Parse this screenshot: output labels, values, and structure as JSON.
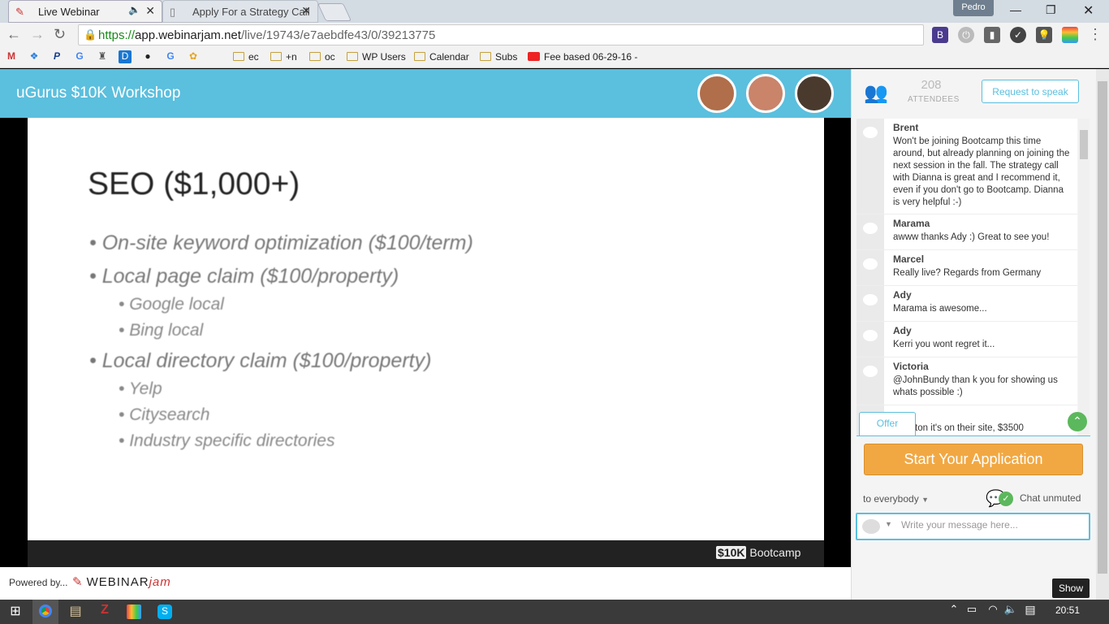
{
  "browser": {
    "tabs": [
      {
        "label": "Live Webinar",
        "icon": "webinarjam-favicon-icon",
        "active": true
      },
      {
        "label": "Apply For a Strategy Call",
        "icon": "page-icon",
        "active": false
      }
    ],
    "profile_name": "Pedro",
    "url": {
      "scheme": "https://",
      "host": "app.webinarjam.net",
      "path": "/live/19743/e7aebdfe43/0/39213775"
    },
    "bookmarks": [
      {
        "label": "ec"
      },
      {
        "label": "+n"
      },
      {
        "label": "oc"
      },
      {
        "label": "WP Users"
      },
      {
        "label": "Calendar"
      },
      {
        "label": "Subs"
      },
      {
        "label": "Fee based 06-29-16 -"
      }
    ]
  },
  "header": {
    "title": "uGurus $10K Workshop",
    "presenters": [
      "presenter-1",
      "presenter-2",
      "presenter-3"
    ]
  },
  "slide": {
    "title": "SEO ($1,000+)",
    "bullets": [
      "On-site keyword optimization ($100/term)",
      "Local page claim ($100/property)",
      "Google local",
      "Bing local",
      "Local directory claim ($100/property)",
      "Yelp",
      "Citysearch",
      "Industry specific directories"
    ],
    "footer_brand_box": "$10K",
    "footer_brand_text": "Bootcamp"
  },
  "powered": {
    "label": "Powered by...",
    "brand_main": "WEBINAR",
    "brand_accent": "jam"
  },
  "panel": {
    "attendees_count": "208",
    "attendees_label": "ATTENDEES",
    "request_button": "Request to speak",
    "messages": [
      {
        "author": "Brent",
        "text": "Won't be joining Bootcamp this time around, but already planning on joining the next session in the fall. The strategy call with Dianna is great and I recommend it, even if you don't go to Bootcamp. Dianna is very helpful :-)"
      },
      {
        "author": "Marama",
        "text": "awww thanks Ady :) Great to see you!"
      },
      {
        "author": "Marcel",
        "text": "Really live? Regards from Germany"
      },
      {
        "author": "Ady",
        "text": "Marama is awesome..."
      },
      {
        "author": "Ady",
        "text": "Kerri you wont regret it..."
      },
      {
        "author": "Victoria",
        "text": "@JohnBundy than k you for showing us whats possible :)"
      },
      {
        "author": "",
        "text": "ton it's on their site, $3500"
      }
    ],
    "offer_tab": "Offer",
    "start_button": "Start Your Application",
    "recipient": "to everybody",
    "chat_status": "Chat unmuted",
    "message_placeholder": "Write your message here...",
    "show_button": "Show"
  },
  "taskbar": {
    "clock": "20:51"
  },
  "colors": {
    "header_blue": "#5bbfde",
    "cta_orange": "#f1a843",
    "accent_green": "#5cb85c"
  }
}
